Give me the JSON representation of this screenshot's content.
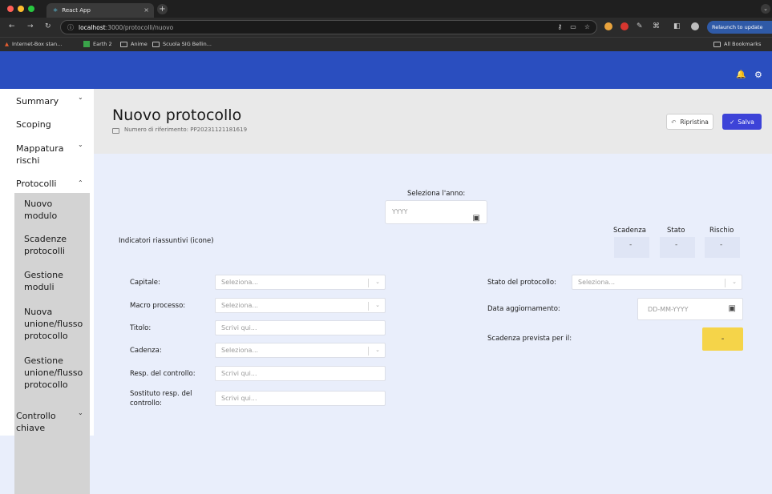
{
  "browser": {
    "tab_title": "React App",
    "tab_close": "×",
    "new_tab": "+",
    "tab_menu": "⌄",
    "nav": {
      "back": "←",
      "forward": "→",
      "reload": "↻"
    },
    "url_host": "localhost",
    "url_rest": ":3000/protocolli/nuovo",
    "relaunch_label": "Relaunch to update",
    "bookmarks": [
      "Internet-Box stan...",
      "Earth 2",
      "Anime",
      "Scuola SIG Bellin..."
    ],
    "all_bookmarks": "All Bookmarks"
  },
  "appbar": {
    "bell_icon": "🔔",
    "gear_icon": "⚙"
  },
  "sidebar": {
    "items": [
      {
        "label": "Summary",
        "chevron": "⌄"
      },
      {
        "label": "Scoping",
        "chevron": ""
      },
      {
        "label": "Mappatura rischi",
        "chevron": "⌄"
      },
      {
        "label": "Protocolli",
        "chevron": "⌃"
      },
      {
        "label": "Controllo chiave",
        "chevron": "⌄"
      }
    ],
    "sub_items": [
      "Nuovo modulo",
      "Scadenze protocolli",
      "Gestione moduli",
      "Nuova unione/flusso protocollo",
      "Gestione unione/flusso protocollo"
    ]
  },
  "header": {
    "title": "Nuovo protocollo",
    "ref_label": "Numero di riferimento: PP20231121181619",
    "reset_label": "Ripristina",
    "save_label": "Salva"
  },
  "year": {
    "label": "Seleziona l'anno:",
    "placeholder": "YYYY"
  },
  "indicators": {
    "label": "Indicatori riassuntivi (icone)",
    "columns": [
      "Scadenza",
      "Stato",
      "Rischio"
    ],
    "values": [
      "-",
      "-",
      "-"
    ]
  },
  "form": {
    "left": [
      {
        "label": "Capitale:",
        "placeholder": "Seleziona...",
        "type": "select"
      },
      {
        "label": "Macro processo:",
        "placeholder": "Seleziona...",
        "type": "select"
      },
      {
        "label": "Titolo:",
        "placeholder": "Scrivi qui...",
        "type": "text"
      },
      {
        "label": "Cadenza:",
        "placeholder": "Seleziona...",
        "type": "select"
      },
      {
        "label": "Resp. del controllo:",
        "placeholder": "Scrivi qui...",
        "type": "text"
      },
      {
        "label": "Sostituto resp. del controllo:",
        "placeholder": "Scrivi qui...",
        "type": "text"
      }
    ],
    "right": {
      "stato_label": "Stato del protocollo:",
      "stato_placeholder": "Seleziona...",
      "data_label": "Data aggiornamento:",
      "data_placeholder": "DD-MM-YYYY",
      "scadenza_label": "Scadenza prevista per il:",
      "scadenza_value": "-"
    }
  }
}
